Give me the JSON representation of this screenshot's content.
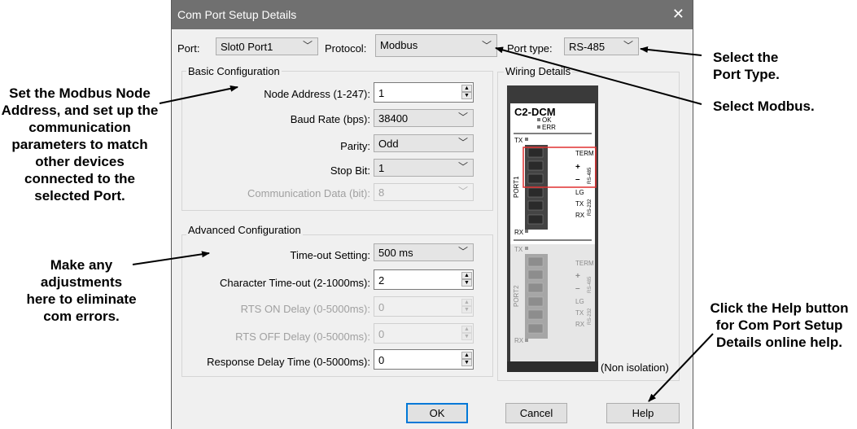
{
  "dialog": {
    "title": "Com Port Setup Details",
    "top_row": {
      "port_label": "Port:",
      "port_value": "Slot0 Port1",
      "protocol_label": "Protocol:",
      "protocol_value": "Modbus",
      "port_type_label": "Port type:",
      "port_type_value": "RS-485"
    },
    "basic": {
      "title": "Basic Configuration",
      "node_address_label": "Node Address (1-247):",
      "node_address_value": "1",
      "baud_rate_label": "Baud Rate (bps):",
      "baud_rate_value": "38400",
      "parity_label": "Parity:",
      "parity_value": "Odd",
      "stop_bit_label": "Stop Bit:",
      "stop_bit_value": "1",
      "comm_data_label": "Communication Data (bit):",
      "comm_data_value": "8"
    },
    "advanced": {
      "title": "Advanced Configuration",
      "timeout_label": "Time-out Setting:",
      "timeout_value": "500 ms",
      "char_timeout_label": "Character Time-out (2-1000ms):",
      "char_timeout_value": "2",
      "rts_on_label": "RTS ON Delay (0-5000ms):",
      "rts_on_value": "0",
      "rts_off_label": "RTS OFF Delay (0-5000ms):",
      "rts_off_value": "0",
      "response_delay_label": "Response Delay Time (0-5000ms):",
      "response_delay_value": "0"
    },
    "wiring": {
      "title": "Wiring Details",
      "module_name": "C2-DCM",
      "ok_label": "OK",
      "err_label": "ERR",
      "tx_label": "TX",
      "rx_label": "RX",
      "port1_label": "PORT1",
      "port2_label": "PORT2",
      "term_label": "TERM",
      "plus_label": "+",
      "minus_label": "–",
      "lg_label": "LG",
      "rs485_label": "RS-485",
      "rs232_label": "RS-232",
      "non_isolation": "(Non isolation)"
    },
    "buttons": {
      "ok": "OK",
      "cancel": "Cancel",
      "help": "Help"
    }
  },
  "callouts": {
    "node_address": "Set the Modbus Node Address, and set up the communication parameters to match other devices connected to the selected Port.",
    "advanced": "Make any adjustments here to eliminate com errors.",
    "port_type": "Select the Port Type.",
    "modbus": "Select Modbus.",
    "help": "Click the Help button for Com Port Setup Details online help."
  },
  "colors": {
    "titlebar": "#707070",
    "dialog_bg": "#f0f0f0",
    "default_button_border": "#0078d7",
    "highlight_box": "#e03030"
  }
}
